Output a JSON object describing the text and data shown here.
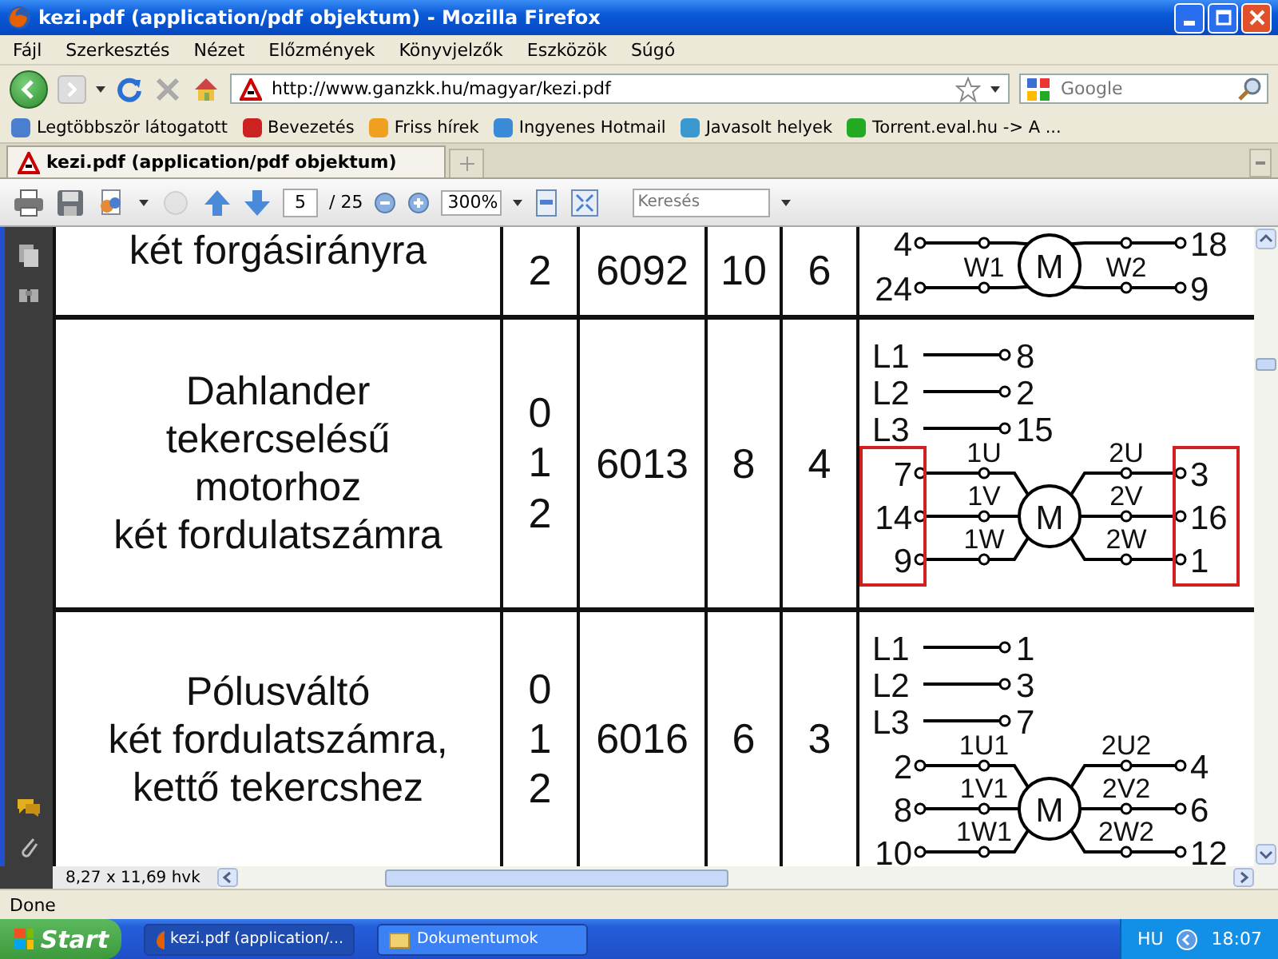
{
  "window": {
    "title": "kezi.pdf (application/pdf objektum) - Mozilla Firefox"
  },
  "menu": [
    "Fájl",
    "Szerkesztés",
    "Nézet",
    "Előzmények",
    "Könyvjelzők",
    "Eszközök",
    "Súgó"
  ],
  "address_bar": {
    "url": "http://www.ganzkk.hu/magyar/kezi.pdf"
  },
  "search_box": {
    "placeholder": "Google"
  },
  "bookmarks": [
    "Legtöbbször látogatott",
    "Bevezetés",
    "Friss hírek",
    "Ingyenes Hotmail",
    "Javasolt helyek",
    "Torrent.eval.hu -> A ..."
  ],
  "tabs": [
    {
      "label": "kezi.pdf (application/pdf objektum)",
      "selected": true
    }
  ],
  "pdf_toolbar": {
    "page": "5",
    "page_count": "/ 25",
    "zoom": "300%",
    "search_placeholder": "Keresés"
  },
  "document": {
    "rows": [
      {
        "description": "két forgásirányra",
        "positions": [
          "2"
        ],
        "code": "6092",
        "column_4": "10",
        "column_5": "6",
        "diagram": {
          "left_terminals": [
            "4",
            "24"
          ],
          "left_windings": [
            "W1"
          ],
          "motor": "M",
          "right_windings": [
            "W2"
          ],
          "right_terminals": [
            "18",
            "9"
          ],
          "highlighted": false
        }
      },
      {
        "description": "Dahlander\ntekercselésű\nmotorhoz\nkét fordulatszámra",
        "positions": [
          "0",
          "1",
          "2"
        ],
        "code": "6013",
        "column_4": "8",
        "column_5": "4",
        "diagram": {
          "supply": [
            {
              "line": "L1",
              "terminal": "8"
            },
            {
              "line": "L2",
              "terminal": "2"
            },
            {
              "line": "L3",
              "terminal": "15"
            }
          ],
          "left_terminals": [
            "7",
            "14",
            "9"
          ],
          "left_windings": [
            "1U",
            "1V",
            "1W"
          ],
          "motor": "M",
          "right_windings": [
            "2U",
            "2V",
            "2W"
          ],
          "right_terminals": [
            "3",
            "16",
            "1"
          ],
          "highlighted": true
        }
      },
      {
        "description": "Pólusváltó\nkét fordulatszámra,\nkettő tekercshez",
        "positions": [
          "0",
          "1",
          "2"
        ],
        "code": "6016",
        "column_4": "6",
        "column_5": "3",
        "diagram": {
          "supply": [
            {
              "line": "L1",
              "terminal": "1"
            },
            {
              "line": "L2",
              "terminal": "3"
            },
            {
              "line": "L3",
              "terminal": "7"
            }
          ],
          "left_terminals": [
            "2",
            "8",
            "10"
          ],
          "left_windings": [
            "1U1",
            "1V1",
            "1W1"
          ],
          "motor": "M",
          "right_windings": [
            "2U2",
            "2V2",
            "2W2"
          ],
          "right_terminals": [
            "4",
            "6",
            "12"
          ],
          "highlighted": false
        }
      }
    ]
  },
  "page_size": "8,27 x 11,69 hvk",
  "status_bar": "Done",
  "taskbar": {
    "start": "Start",
    "tasks": [
      {
        "label": "kezi.pdf (application/...",
        "selected": true
      },
      {
        "label": "Dokumentumok",
        "selected": false
      }
    ],
    "language": "HU",
    "clock": "18:07"
  }
}
